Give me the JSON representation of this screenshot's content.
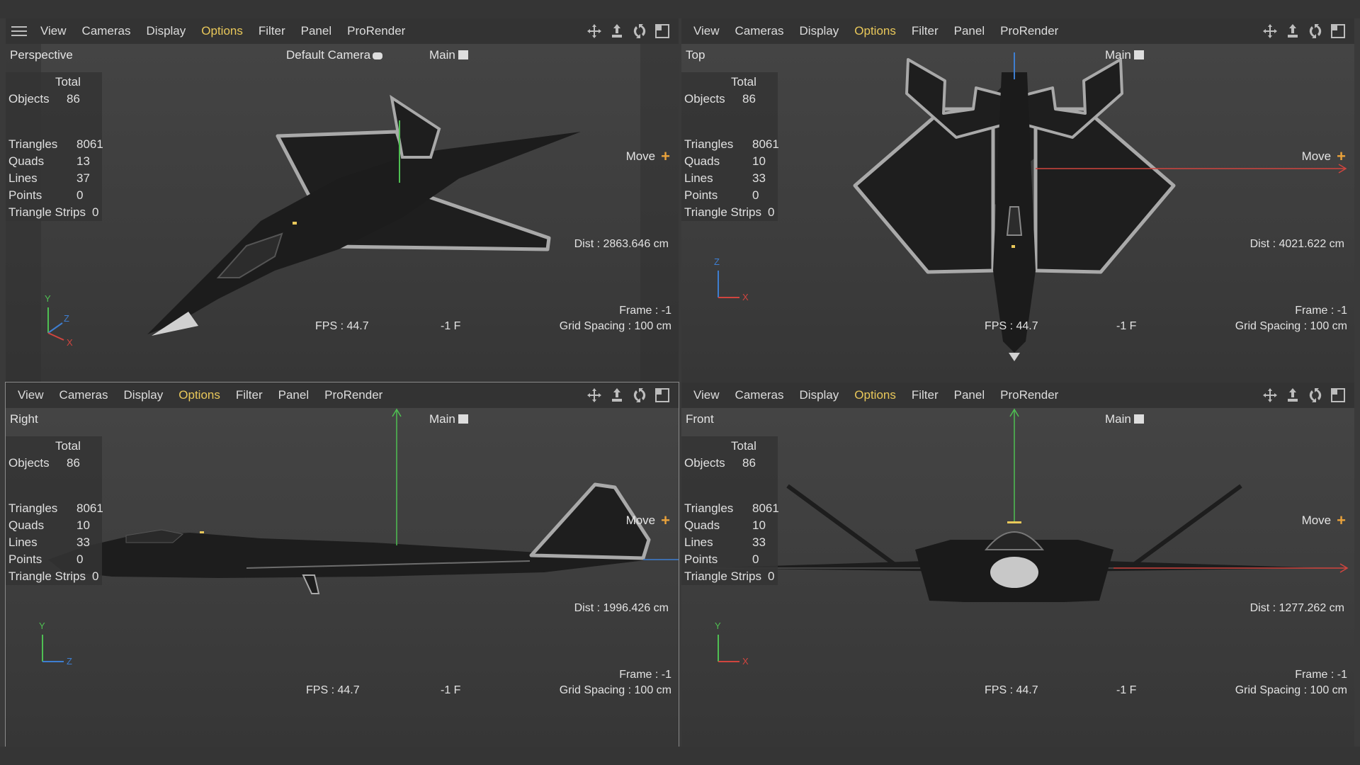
{
  "menu": {
    "items": [
      "View",
      "Cameras",
      "Display",
      "Options",
      "Filter",
      "Panel",
      "ProRender"
    ],
    "highlighted": "Options",
    "highlight_color": "#e9c85a"
  },
  "toolbar_icons": [
    "move-view-icon",
    "pan-view-icon",
    "rotate-view-icon",
    "toggle-layout-icon"
  ],
  "stats_labels": {
    "total": "Total",
    "objects": "Objects",
    "triangles": "Triangles",
    "quads": "Quads",
    "lines": "Lines",
    "points": "Points",
    "triangle_strips": "Triangle Strips"
  },
  "viewports": [
    {
      "name": "Perspective",
      "camera": "Default Camera",
      "main": "Main",
      "stats": {
        "objects": "86",
        "triangles": "8061",
        "quads": "13",
        "lines": "37",
        "points": "0",
        "triangle_strips": "0"
      },
      "move": "Move",
      "dist": "Dist : 2863.646 cm",
      "frame": "Frame : -1",
      "fps": "FPS : 44.7",
      "fnum": "-1 F",
      "grid": "Grid Spacing : 100 cm",
      "axes": [
        "Y",
        "Z",
        "X"
      ]
    },
    {
      "name": "Top",
      "camera": "",
      "main": "Main",
      "stats": {
        "objects": "86",
        "triangles": "8061",
        "quads": "10",
        "lines": "33",
        "points": "0",
        "triangle_strips": "0"
      },
      "move": "Move",
      "dist": "Dist : 4021.622 cm",
      "frame": "Frame : -1",
      "fps": "FPS : 44.7",
      "fnum": "-1 F",
      "grid": "Grid Spacing : 100 cm",
      "axes": [
        "Z",
        "X"
      ]
    },
    {
      "name": "Right",
      "camera": "",
      "main": "Main",
      "stats": {
        "objects": "86",
        "triangles": "8061",
        "quads": "10",
        "lines": "33",
        "points": "0",
        "triangle_strips": "0"
      },
      "move": "Move",
      "dist": "Dist : 1996.426 cm",
      "frame": "Frame : -1",
      "fps": "FPS : 44.7",
      "fnum": "-1 F",
      "grid": "Grid Spacing : 100 cm",
      "axes": [
        "Y",
        "Z"
      ]
    },
    {
      "name": "Front",
      "camera": "",
      "main": "Main",
      "stats": {
        "objects": "86",
        "triangles": "8061",
        "quads": "10",
        "lines": "33",
        "points": "0",
        "triangle_strips": "0"
      },
      "move": "Move",
      "dist": "Dist : 1277.262 cm",
      "frame": "Frame : -1",
      "fps": "FPS : 44.7",
      "fnum": "-1 F",
      "grid": "Grid Spacing : 100 cm",
      "axes": [
        "Y",
        "X"
      ]
    }
  ],
  "colors": {
    "axis_x": "#d0453f",
    "axis_y": "#4fbf52",
    "axis_z": "#3e7ed0",
    "move_plus": "#e9a23b"
  }
}
